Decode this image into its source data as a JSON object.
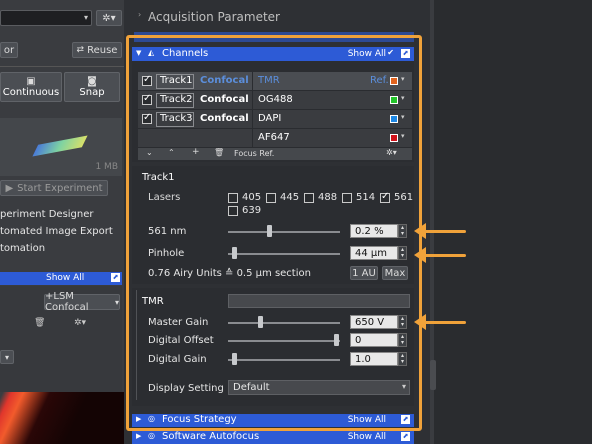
{
  "left": {
    "reuse_label": "Reuse",
    "or_label": "or",
    "continuous_label": "Continuous",
    "snap_label": "Snap",
    "size_label": "1 MB",
    "start_label": "Start Experiment",
    "menu_items": [
      "periment Designer",
      "tomated Image Export",
      "tomation"
    ],
    "show_all_label": "Show All",
    "lsm_label": "+LSM Confocal"
  },
  "header": {
    "title": "Acquisition Parameter"
  },
  "channels": {
    "title": "Channels",
    "show_all": "Show All",
    "tracks": [
      {
        "name": "Track1",
        "mode": "Confocal",
        "dye": "TMR",
        "ref": "Ref.",
        "color": "#e2641f",
        "selected": true
      },
      {
        "name": "Track2",
        "mode": "Confocal",
        "dye": "OG488",
        "ref": "",
        "color": "#22c42a",
        "selected": false
      },
      {
        "name": "Track3",
        "mode": "Confocal",
        "dye": "DAPI",
        "ref": "",
        "color": "#1e88e5",
        "selected": false
      },
      {
        "name": "",
        "mode": "",
        "dye": "AF647",
        "ref": "",
        "color": "#d0121b",
        "selected": false
      }
    ],
    "focus_ref": "Focus Ref."
  },
  "track1": {
    "title": "Track1",
    "lasers_label": "Lasers",
    "lasers": [
      {
        "nm": "405",
        "checked": false
      },
      {
        "nm": "445",
        "checked": false
      },
      {
        "nm": "488",
        "checked": false
      },
      {
        "nm": "514",
        "checked": false
      },
      {
        "nm": "561",
        "checked": true
      },
      {
        "nm": "639",
        "checked": false
      }
    ],
    "laser561_label": "561 nm",
    "laser561_value": "0.2 %",
    "pinhole_label": "Pinhole",
    "pinhole_value": "44 µm",
    "airy_text": "0.76 Airy Units ≙ 0.5 µm section",
    "one_au": "1 AU",
    "max": "Max"
  },
  "tmr": {
    "title": "TMR",
    "master_gain_label": "Master Gain",
    "master_gain_value": "650 V",
    "digital_offset_label": "Digital Offset",
    "digital_offset_value": "0",
    "digital_gain_label": "Digital Gain",
    "digital_gain_value": "1.0",
    "display_setting_label": "Display Setting",
    "display_setting_value": "Default"
  },
  "focus_strategy": {
    "title": "Focus Strategy",
    "show_all": "Show All"
  },
  "software_autofocus": {
    "title": "Software Autofocus",
    "show_all": "Show All"
  },
  "colors": {
    "accent": "#2d5bd6",
    "highlight_box": "#f0a23a"
  }
}
